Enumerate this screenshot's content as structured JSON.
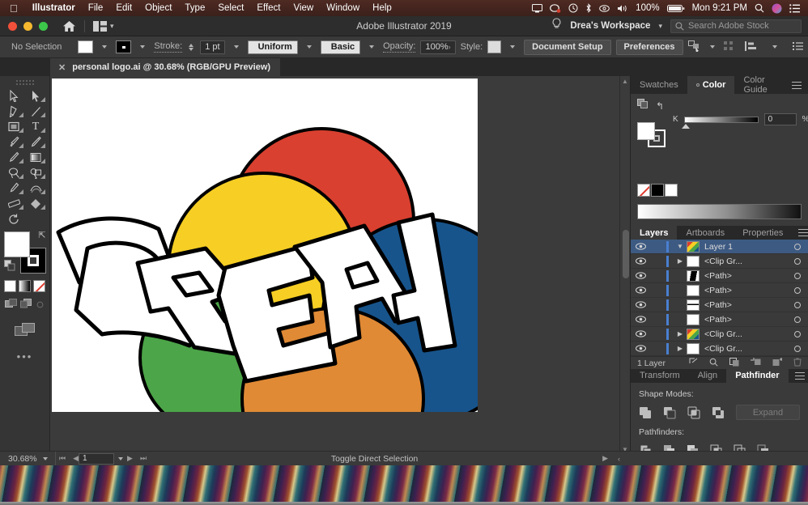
{
  "menubar": {
    "apple": "apple-logo",
    "items": [
      {
        "label": "Illustrator",
        "bold": true
      },
      {
        "label": "File",
        "bold": false
      },
      {
        "label": "Edit",
        "bold": false
      },
      {
        "label": "Object",
        "bold": false
      },
      {
        "label": "Type",
        "bold": false
      },
      {
        "label": "Select",
        "bold": false
      },
      {
        "label": "Effect",
        "bold": false
      },
      {
        "label": "View",
        "bold": false
      },
      {
        "label": "Window",
        "bold": false
      },
      {
        "label": "Help",
        "bold": false
      }
    ],
    "status_icons": [
      "screen-share-icon",
      "dropbox-icon",
      "time-machine-icon",
      "bluetooth-icon",
      "airdrop-icon",
      "volume-icon"
    ],
    "battery_percent": "100%",
    "clock": "Mon 9:21 PM",
    "search_icon": "spotlight-search-icon",
    "siri_icon": "siri-icon",
    "control_center_icon": "control-center-icon"
  },
  "titlebar": {
    "home_icon": "home-icon",
    "arrange_icon": "arrange-documents-icon",
    "title": "Adobe Illustrator 2019",
    "hint_icon": "lightbulb-icon",
    "workspace": "Drea's Workspace",
    "search_placeholder": "Search Adobe Stock"
  },
  "controlbar": {
    "selection_status": "No Selection",
    "fill_label": "fill-swatch",
    "stroke_swatch_label": "stroke-swatch",
    "stroke_label": "Stroke:",
    "stroke_weight": "1 pt",
    "profile": "Uniform",
    "brush": "Basic",
    "opacity_label": "Opacity:",
    "opacity_value": "100%",
    "style_label": "Style:",
    "document_setup": "Document Setup",
    "preferences": "Preferences",
    "select_similar_icon": "select-similar-objects-icon",
    "align_icon": "align-icon",
    "options_icon": "panel-options-icon"
  },
  "document": {
    "tab_title": "personal logo.ai @ 30.68% (RGB/GPU Preview)",
    "close_icon": "close-icon"
  },
  "tools": [
    {
      "name": "selection-tool",
      "glyph": "arrow-outline"
    },
    {
      "name": "direct-selection-tool",
      "glyph": "arrow-filled"
    },
    {
      "name": "pen-tool",
      "glyph": "pen"
    },
    {
      "name": "line-segment-tool",
      "glyph": "line"
    },
    {
      "name": "rectangle-tool",
      "glyph": "rect"
    },
    {
      "name": "type-tool",
      "glyph": "T"
    },
    {
      "name": "paintbrush-tool",
      "glyph": "brush"
    },
    {
      "name": "pencil-tool",
      "glyph": "pencil"
    },
    {
      "name": "eraser-tool",
      "glyph": "eraser-pen"
    },
    {
      "name": "gradient-tool",
      "glyph": "gradient"
    },
    {
      "name": "lasso-tool",
      "glyph": "lasso"
    },
    {
      "name": "shape-builder-tool",
      "glyph": "shape-builder"
    },
    {
      "name": "eyedropper-tool",
      "glyph": "eyedropper"
    },
    {
      "name": "blend-tool",
      "glyph": "blend"
    },
    {
      "name": "measure-tool",
      "glyph": "ruler"
    },
    {
      "name": "free-transform-tool",
      "glyph": "diamond"
    },
    {
      "name": "rotate-tool",
      "glyph": "rotate"
    }
  ],
  "toolbar_bottom": {
    "fill_color": "#ffffff",
    "stroke_color": "#000000",
    "swap_icon": "swap-fill-stroke-icon",
    "default_icon": "default-fill-stroke-icon",
    "color_modes": [
      "color-mode-icon",
      "gradient-mode-icon",
      "none-mode-icon"
    ],
    "draw_modes": [
      "draw-normal-icon",
      "draw-behind-icon",
      "draw-inside-icon"
    ],
    "screen_mode_icon": "change-screen-mode-icon",
    "edit_toolbar_icon": "edit-toolbar-ellipsis"
  },
  "artwork": {
    "description": "Graffiti wordmark DREA over five overlapping circles",
    "wordmark": "DREA",
    "circles": [
      {
        "name": "red-circle",
        "color": "#d9402f"
      },
      {
        "name": "yellow-circle",
        "color": "#f6ce24"
      },
      {
        "name": "blue-circle",
        "color": "#17548c"
      },
      {
        "name": "green-circle",
        "color": "#4ca548"
      },
      {
        "name": "orange-circle",
        "color": "#e08a35"
      }
    ],
    "letter_fill": "#ffffff",
    "outline": "#000000"
  },
  "color_panel": {
    "tabs": [
      {
        "label": "Swatches",
        "active": false
      },
      {
        "label": "Color",
        "active": true
      },
      {
        "label": "Color Guide",
        "active": false
      }
    ],
    "menu_icon": "panel-menu-icon",
    "fill_stroke_icon": "fill-stroke-proxy-icon",
    "revert_icon": "revert-color-icon",
    "channel_label": "K",
    "channel_value": "0",
    "unit": "%",
    "none_swatch": "none-swatch",
    "black_swatch": "black-swatch",
    "white_swatch": "white-swatch",
    "spectrum": "grayscale-spectrum-ramp"
  },
  "layers_panel": {
    "tabs": [
      {
        "label": "Layers",
        "active": true
      },
      {
        "label": "Artboards",
        "active": false
      },
      {
        "label": "Properties",
        "active": false
      }
    ],
    "menu_icon": "panel-menu-icon",
    "rows": [
      {
        "name": "Layer 1",
        "selected": true,
        "expandable": true,
        "thumb": "artwork-thumb"
      },
      {
        "name": "<Clip Gr...",
        "selected": false,
        "expandable": true,
        "thumb": "clip-group-thumb"
      },
      {
        "name": "<Path>",
        "selected": false,
        "expandable": false,
        "thumb": "path-thumb-black"
      },
      {
        "name": "<Path>",
        "selected": false,
        "expandable": false,
        "thumb": "path-thumb-white"
      },
      {
        "name": "<Path>",
        "selected": false,
        "expandable": false,
        "thumb": "path-thumb-line"
      },
      {
        "name": "<Path>",
        "selected": false,
        "expandable": false,
        "thumb": "path-thumb-white"
      },
      {
        "name": "<Clip Gr...",
        "selected": false,
        "expandable": true,
        "thumb": "clip-group-color-thumb"
      },
      {
        "name": "<Clip Gr...",
        "selected": false,
        "expandable": true,
        "thumb": "clip-group-white-thumb"
      }
    ],
    "footer_count": "1 Layer",
    "footer_icons": [
      "locate-object-icon",
      "search-icon",
      "make-mask-icon",
      "create-sublayer-icon",
      "new-layer-icon",
      "delete-layer-icon"
    ]
  },
  "pathfinder_panel": {
    "tabs": [
      {
        "label": "Transform",
        "active": false
      },
      {
        "label": "Align",
        "active": false
      },
      {
        "label": "Pathfinder",
        "active": true
      }
    ],
    "menu_icon": "panel-menu-icon",
    "shape_modes_label": "Shape Modes:",
    "shape_modes": [
      "unite-icon",
      "minus-front-icon",
      "intersect-icon",
      "exclude-icon"
    ],
    "expand_label": "Expand",
    "pathfinders_label": "Pathfinders:",
    "pathfinders": [
      "divide-icon",
      "trim-icon",
      "merge-icon",
      "crop-icon",
      "outline-icon",
      "minus-back-icon"
    ]
  },
  "statusbar": {
    "zoom": "30.68%",
    "first_icon": "first-artboard-icon",
    "prev_icon": "previous-artboard-icon",
    "page": "1",
    "next_icon": "next-artboard-icon",
    "last_icon": "last-artboard-icon",
    "mode_text": "Toggle Direct Selection",
    "play_icon": "status-menu-icon",
    "drag_icon": "resize-grip-icon"
  },
  "colors": {
    "app_bg": "#323232",
    "panel_bg": "#3a3a3a",
    "canvas_bg": "#3b3b3b",
    "selection_blue": "#3d5a82",
    "menubar": "#4e2a22"
  }
}
